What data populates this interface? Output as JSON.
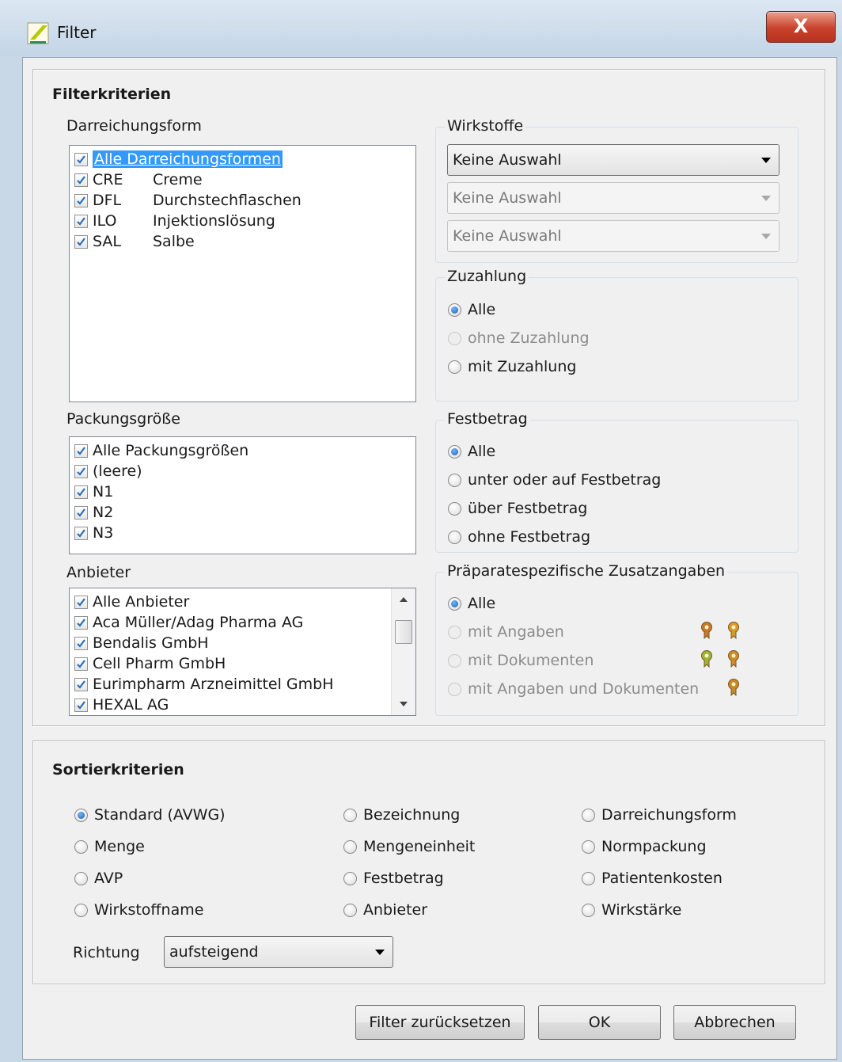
{
  "window": {
    "title": "Filter",
    "close_glyph": "X",
    "icon": "app-logo-icon"
  },
  "filter": {
    "title": "Filterkriterien",
    "darreichungsform": {
      "label": "Darreichungsform",
      "items": [
        {
          "code": "",
          "name": "Alle Darreichungsformen",
          "checked": true,
          "selected": true
        },
        {
          "code": "CRE",
          "name": "Creme",
          "checked": true
        },
        {
          "code": "DFL",
          "name": "Durchstechflaschen",
          "checked": true
        },
        {
          "code": "ILO",
          "name": "Injektionslösung",
          "checked": true
        },
        {
          "code": "SAL",
          "name": "Salbe",
          "checked": true
        }
      ]
    },
    "packungsgroesse": {
      "label": "Packungsgröße",
      "items": [
        "Alle Packungsgrößen",
        "(leere)",
        "N1",
        "N2",
        "N3"
      ]
    },
    "anbieter": {
      "label": "Anbieter",
      "items": [
        "Alle Anbieter",
        "Aca Müller/Adag Pharma AG",
        "Bendalis GmbH",
        "Cell Pharm GmbH",
        "Eurimpharm Arzneimittel GmbH",
        "HEXAL AG"
      ]
    },
    "wirkstoffe": {
      "label": "Wirkstoffe",
      "combos": [
        {
          "value": "Keine Auswahl",
          "enabled": true
        },
        {
          "value": "Keine Auswahl",
          "enabled": false
        },
        {
          "value": "Keine Auswahl",
          "enabled": false
        }
      ]
    },
    "zuzahlung": {
      "label": "Zuzahlung",
      "options": [
        {
          "label": "Alle",
          "checked": true,
          "enabled": true
        },
        {
          "label": "ohne Zuzahlung",
          "checked": false,
          "enabled": false
        },
        {
          "label": "mit Zuzahlung",
          "checked": false,
          "enabled": true
        }
      ]
    },
    "festbetrag": {
      "label": "Festbetrag",
      "options": [
        {
          "label": "Alle",
          "checked": true
        },
        {
          "label": "unter oder auf Festbetrag",
          "checked": false
        },
        {
          "label": "über Festbetrag",
          "checked": false
        },
        {
          "label": "ohne Festbetrag",
          "checked": false
        }
      ]
    },
    "zusatzangaben": {
      "label": "Präparatespezifische Zusatzangaben",
      "options": [
        {
          "label": "Alle",
          "checked": true,
          "enabled": true,
          "pins": []
        },
        {
          "label": "mit Angaben",
          "checked": false,
          "enabled": false,
          "pins": [
            "#c8782a",
            "#d79a2a"
          ]
        },
        {
          "label": "mit Dokumenten",
          "checked": false,
          "enabled": false,
          "pins": [
            "#9fb23a",
            "#d08a2a"
          ]
        },
        {
          "label": "mit Angaben und Dokumenten",
          "checked": false,
          "enabled": false,
          "pins": [
            "#c8882a"
          ]
        }
      ]
    }
  },
  "sort": {
    "title": "Sortierkriterien",
    "columns": [
      [
        "Standard (AVWG)",
        "Menge",
        "AVP",
        "Wirkstoffname"
      ],
      [
        "Bezeichnung",
        "Mengeneinheit",
        "Festbetrag",
        "Anbieter"
      ],
      [
        "Darreichungsform",
        "Normpackung",
        "Patientenkosten",
        "Wirkstärke"
      ]
    ],
    "selected": "Standard (AVWG)",
    "direction_label": "Richtung",
    "direction_value": "aufsteigend"
  },
  "buttons": {
    "reset": "Filter zurücksetzen",
    "ok": "OK",
    "cancel": "Abbrechen"
  },
  "colors": {
    "selection": "#3399ff",
    "close": "#c9412b",
    "checkmark": "#2a6fb8"
  }
}
